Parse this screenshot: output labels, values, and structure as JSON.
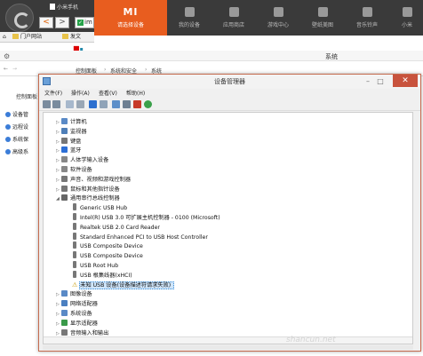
{
  "browser": {
    "tab_title": "小米手机",
    "address_text": "im",
    "address_badge": "✓"
  },
  "top_tabs": [
    {
      "label": "请选择设备",
      "icon": "mi-logo"
    },
    {
      "label": "我的设备",
      "icon": "phone-icon"
    },
    {
      "label": "应用商店",
      "icon": "store-icon"
    },
    {
      "label": "游戏中心",
      "icon": "gamepad-icon"
    },
    {
      "label": "壁纸美图",
      "icon": "picture-icon"
    },
    {
      "label": "音乐铃声",
      "icon": "music-icon"
    },
    {
      "label": "小米",
      "icon": "more-icon"
    }
  ],
  "mi_logo_text": "MI",
  "bookmarks": [
    "门户网站",
    "发文"
  ],
  "explorer": {
    "title": "系统",
    "breadcrumb": [
      "控制面板",
      "系统和安全",
      "系统"
    ],
    "side_head": "控制面板",
    "side_items": [
      "设备管",
      "远程设",
      "系统保",
      "高级系"
    ]
  },
  "device_manager": {
    "title": "设备管理器",
    "menu": [
      "文件(F)",
      "操作(A)",
      "查看(V)",
      "帮助(H)"
    ],
    "tree": [
      {
        "label": "计算机",
        "level": 1,
        "color": "#5a8ac6"
      },
      {
        "label": "监视器",
        "level": 1,
        "color": "#4f7fb8"
      },
      {
        "label": "键盘",
        "level": 1,
        "color": "#777777"
      },
      {
        "label": "蓝牙",
        "level": 1,
        "color": "#2d6fd6"
      },
      {
        "label": "人体学输入设备",
        "level": 1,
        "color": "#888888"
      },
      {
        "label": "软件设备",
        "level": 1,
        "color": "#888888"
      },
      {
        "label": "声音、视频和游戏控制器",
        "level": 1,
        "color": "#777777"
      },
      {
        "label": "鼠标和其他指针设备",
        "level": 1,
        "color": "#777777"
      },
      {
        "label": "通用串行总线控制器",
        "level": 1,
        "color": "#666666",
        "expanded": true
      },
      {
        "label": "Generic USB Hub",
        "level": 2
      },
      {
        "label": "Intel(R) USB 3.0 可扩展主机控制器 - 0100 (Microsoft)",
        "level": 2
      },
      {
        "label": "Realtek USB 2.0 Card Reader",
        "level": 2
      },
      {
        "label": "Standard Enhanced PCI to USB Host Controller",
        "level": 2
      },
      {
        "label": "USB Composite Device",
        "level": 2
      },
      {
        "label": "USB Composite Device",
        "level": 2
      },
      {
        "label": "USB Root Hub",
        "level": 2
      },
      {
        "label": "USB 根集线器(xHCI)",
        "level": 2
      },
      {
        "label": "未知 USB 设备(设备描述符请求失败)",
        "level": 2,
        "warning": true,
        "selected": true
      },
      {
        "label": "图像设备",
        "level": 1,
        "color": "#5a8ac6"
      },
      {
        "label": "网络适配器",
        "level": 1,
        "color": "#4a7fc0"
      },
      {
        "label": "系统设备",
        "level": 1,
        "color": "#5a8ac6"
      },
      {
        "label": "显示适配器",
        "level": 1,
        "color": "#3a9a4a"
      },
      {
        "label": "音频输入和输出",
        "level": 1,
        "color": "#777777"
      }
    ]
  },
  "watermark": "shancun.net"
}
